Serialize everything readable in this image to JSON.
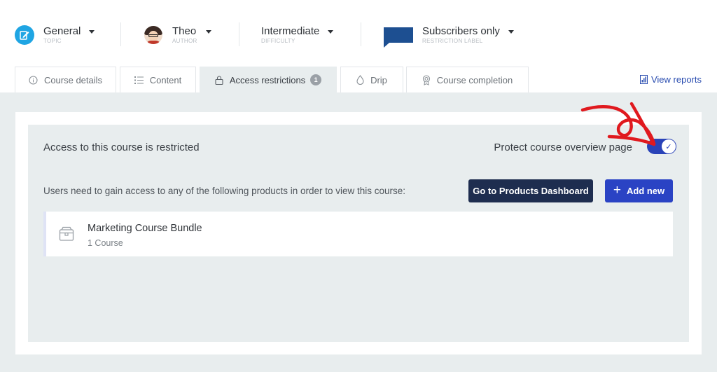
{
  "meta": {
    "topic": {
      "value": "General",
      "label": "TOPIC",
      "icon": "topic-edit-icon"
    },
    "author": {
      "value": "Theo",
      "label": "AUTHOR",
      "icon": "avatar"
    },
    "difficulty": {
      "value": "Intermediate",
      "label": "DIFFICULTY"
    },
    "restriction": {
      "value": "Subscribers only",
      "label": "RESTRICTION LABEL",
      "color": "#1d4f91"
    }
  },
  "tabs": [
    {
      "label": "Course details",
      "icon": "info-icon"
    },
    {
      "label": "Content",
      "icon": "list-icon"
    },
    {
      "label": "Access restrictions",
      "icon": "lock-icon",
      "badge": "1",
      "active": true
    },
    {
      "label": "Drip",
      "icon": "drop-icon"
    },
    {
      "label": "Course completion",
      "icon": "award-icon"
    }
  ],
  "view_reports": "View reports",
  "access": {
    "title": "Access to this course is restricted",
    "protect_label": "Protect course overview page",
    "protect_enabled": true,
    "description": "Users need to gain access to any of the following products in order to view this course:",
    "dashboard_button": "Go to Products Dashboard",
    "add_button": "Add new",
    "products": [
      {
        "name": "Marketing Course Bundle",
        "count": "1 Course",
        "icon": "box-icon"
      }
    ]
  },
  "colors": {
    "accent": "#2a43c4",
    "dark_button": "#1e2d4f",
    "background": "#e8edee",
    "annotation": "#e0191e"
  }
}
